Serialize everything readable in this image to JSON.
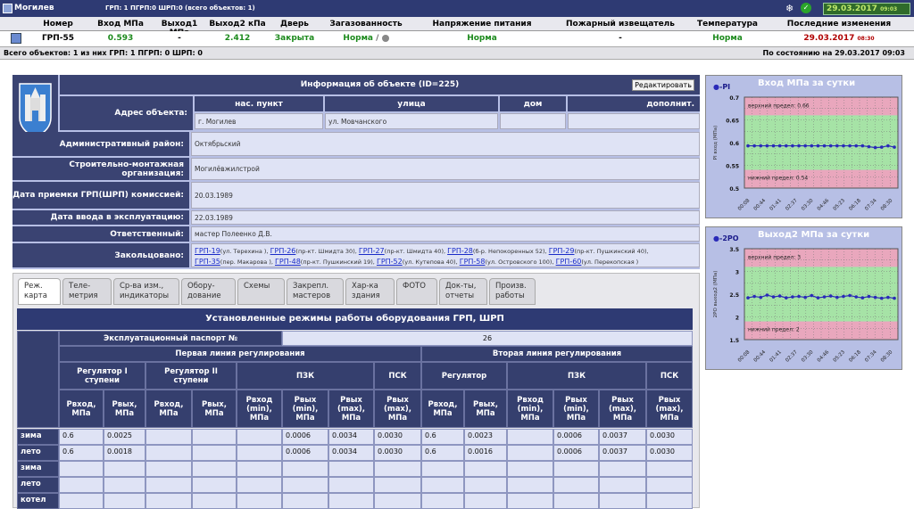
{
  "topbar": {
    "city": "Могилев",
    "counts": "ГРП: 1   ПГРП:0   ШРП:0   (всего объектов: 1)",
    "date": "29.03.2017",
    "time": "09:03"
  },
  "table_header": [
    "Номер",
    "Вход МПа",
    "Выход1 МПа",
    "Выход2 кПа",
    "Дверь",
    "Загазованность",
    "Напряжение питания",
    "Пожарный извещатель",
    "Температура",
    "Последние изменения"
  ],
  "row": {
    "number": "ГРП-55",
    "in": "0.593",
    "out1": "-",
    "out2": "2.412",
    "door": "Закрыта",
    "gas": "Норма",
    "gas_sep": "/",
    "power": "Норма",
    "fire": "-",
    "temp": "Норма",
    "changed_date": "29.03.2017",
    "changed_time": "08:30"
  },
  "summary": {
    "left": "Всего объектов: 1   из них  ГРП: 1   ПГРП: 0   ШРП: 0",
    "right": "По состоянию на 29.03.2017 09:03"
  },
  "info": {
    "title": "Информация об объекте (ID=225)",
    "edit": "Редактировать",
    "addr_label": "Адрес объекта:",
    "addr_cols": [
      "нас. пункт",
      "улица",
      "дом",
      "дополнит."
    ],
    "addr_vals": [
      "г. Могилев",
      "ул. Мовчанского",
      "",
      ""
    ],
    "district_label": "Административный район:",
    "district": "Октябрьский",
    "org_label": "Строительно-монтажная организация:",
    "org": "Могилёвжилстрой",
    "accept_label": "Дата приемки ГРП(ШРП) комиссией:",
    "accept": "20.03.1989",
    "commission_label": "Дата ввода в эксплуатацию:",
    "commission": "22.03.1989",
    "resp_label": "Ответственный:",
    "resp": "мастер Полеенко Д.В.",
    "ring_label": "Закольцовано:",
    "ring_line1": [
      {
        "id": "ГРП-19",
        "addr": "(ул. Терехина ), "
      },
      {
        "id": "ГРП-26",
        "addr": "(пр-кт. Шмидта 30), "
      },
      {
        "id": "ГРП-27",
        "addr": "(пр-кт. Шмидта 40), "
      },
      {
        "id": "ГРП-28",
        "addr": "(б-р. Непокоренных 52), "
      },
      {
        "id": "ГРП-29",
        "addr": "(пр-кт. Пушкинский 40),"
      }
    ],
    "ring_line2": [
      {
        "id": "ГРП-35",
        "addr": "(пер. Макарова ), "
      },
      {
        "id": "ГРП-48",
        "addr": "(пр-кт. Пушкинский 19), "
      },
      {
        "id": "ГРП-52",
        "addr": "(ул. Кутепова 40), "
      },
      {
        "id": "ГРП-58",
        "addr": "(ул. Островского 100), "
      },
      {
        "id": "ГРП-60",
        "addr": "(ул. Перекопская )"
      }
    ]
  },
  "tabs": [
    "Реж. карта",
    "Теле- метрия",
    "Ср-ва изм., индикаторы",
    "Обору- дование",
    "Схемы",
    "Закрепл. мастеров",
    "Хар-ка здания",
    "ФОТО",
    "Док-ты, отчеты",
    "Произв. работы"
  ],
  "modes": {
    "title": "Установленные режимы работы оборудования ГРП, ШРП",
    "passport_label": "Эксплуатационный паспорт №",
    "passport": "26",
    "line1": "Первая линия регулирования",
    "line2": "Вторая линия регулирования",
    "reg1": "Регулятор I ступени",
    "reg2": "Регулятор II ступени",
    "pzk": "ПЗК",
    "psk": "ПСК",
    "reg": "Регулятор",
    "p_in": "Pвход, МПа",
    "p_out": "Pвых, МПа",
    "p_in_min": "Pвход (min), МПа",
    "p_out_min": "Pвых (min), МПа",
    "p_out_max": "Pвых (max), МПа",
    "rows": [
      {
        "name": "зима",
        "v": [
          "0.6",
          "0.0025",
          "",
          "",
          "",
          "0.0006",
          "0.0034",
          "0.0030",
          "0.6",
          "0.0023",
          "",
          "0.0006",
          "0.0037",
          "0.0030"
        ]
      },
      {
        "name": "лето",
        "v": [
          "0.6",
          "0.0018",
          "",
          "",
          "",
          "0.0006",
          "0.0034",
          "0.0030",
          "0.6",
          "0.0016",
          "",
          "0.0006",
          "0.0037",
          "0.0030"
        ]
      },
      {
        "name": "зима",
        "v": [
          "",
          "",
          "",
          "",
          "",
          "",
          "",
          "",
          "",
          "",
          "",
          "",
          "",
          ""
        ]
      },
      {
        "name": "лето",
        "v": [
          "",
          "",
          "",
          "",
          "",
          "",
          "",
          "",
          "",
          "",
          "",
          "",
          "",
          ""
        ]
      },
      {
        "name": "котел",
        "v": [
          "",
          "",
          "",
          "",
          "",
          "",
          "",
          "",
          "",
          "",
          "",
          "",
          "",
          ""
        ]
      }
    ]
  },
  "chart_data": [
    {
      "type": "line",
      "title": "Вход МПа за сутки",
      "legend": "PI",
      "ylabel": "PI вход (МПа)",
      "ylim": [
        0.5,
        0.7
      ],
      "yticks": [
        "0.7",
        "0.65",
        "0.6",
        "0.55",
        "0.5"
      ],
      "upper_label": "верхний предел: 0.66",
      "lower_label": "нижний предел: 0.54",
      "x": [
        "00:08",
        "00:44",
        "01:41",
        "02:37",
        "03:30",
        "04:46",
        "05:23",
        "06:18",
        "07:34",
        "08:30"
      ],
      "values": [
        0.593,
        0.593,
        0.593,
        0.593,
        0.593,
        0.593,
        0.593,
        0.593,
        0.593,
        0.593,
        0.593,
        0.593,
        0.593,
        0.593,
        0.593,
        0.593,
        0.593,
        0.593,
        0.593,
        0.591,
        0.589,
        0.59,
        0.593,
        0.59
      ],
      "color": "#2a2ab8"
    },
    {
      "type": "line",
      "title": "Выход2 МПа за сутки",
      "legend": "2PO",
      "ylabel": "2PO выход2 (МПа)",
      "ylim": [
        1.5,
        3.5
      ],
      "yticks": [
        "3.5",
        "3",
        "2.5",
        "2",
        "1.5"
      ],
      "upper_label": "верхний предел: 3",
      "lower_label": "нижний предел: 2",
      "x": [
        "00:08",
        "00:44",
        "01:41",
        "02:37",
        "03:30",
        "04:46",
        "05:23",
        "06:18",
        "07:34",
        "08:30"
      ],
      "values": [
        2.42,
        2.45,
        2.43,
        2.48,
        2.44,
        2.46,
        2.42,
        2.44,
        2.45,
        2.43,
        2.47,
        2.42,
        2.44,
        2.46,
        2.43,
        2.45,
        2.47,
        2.44,
        2.42,
        2.45,
        2.43,
        2.41,
        2.43,
        2.41
      ],
      "color": "#2a2ab8"
    }
  ]
}
